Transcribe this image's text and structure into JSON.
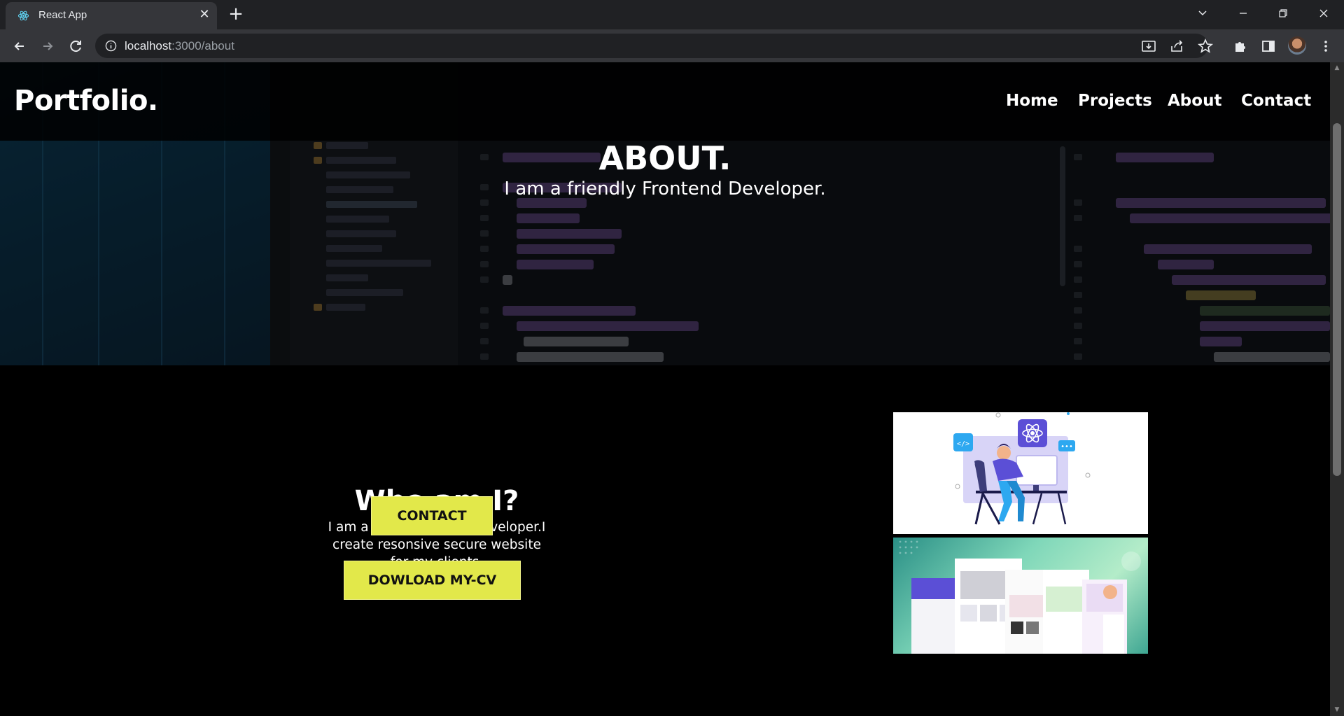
{
  "browser": {
    "tab_title": "React App",
    "url_host": "localhost",
    "url_path": ":3000/about"
  },
  "navbar": {
    "logo": "Portfolio.",
    "links": [
      "Home",
      "Projects",
      "About",
      "Contact"
    ]
  },
  "hero": {
    "title": "ABOUT.",
    "subtitle": "I am a friendly Frontend Developer."
  },
  "about": {
    "heading": "Who am I?",
    "description": "I am a react front-end developer.I create resonsive secure website for my clients.",
    "contact_button": "CONTACT",
    "cv_button": "DOWLOAD MY-CV"
  },
  "colors": {
    "accent": "#e2e84a",
    "page_background": "#000000",
    "text": "#ffffff"
  },
  "icons": [
    "react-favicon-icon",
    "close-icon",
    "plus-icon",
    "back-icon",
    "forward-icon",
    "reload-icon",
    "info-icon",
    "install-icon",
    "share-icon",
    "star-icon",
    "extensions-icon",
    "side-panel-icon",
    "menu-icon"
  ]
}
